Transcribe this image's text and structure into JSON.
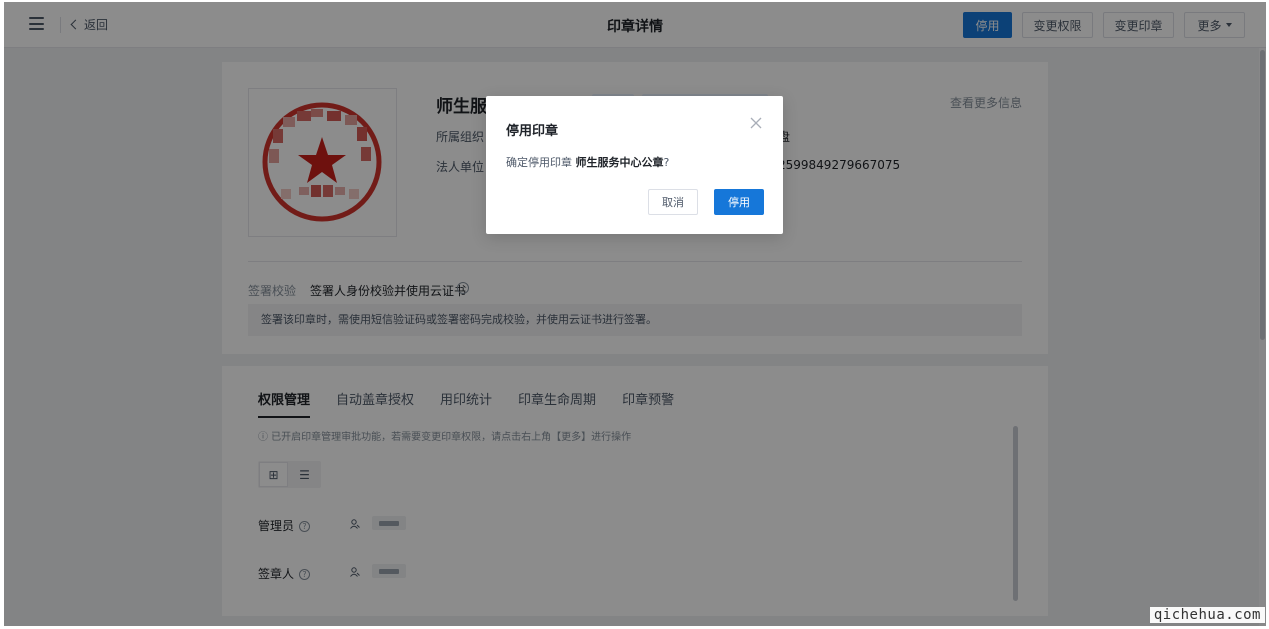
{
  "header": {
    "back_label": "返回",
    "title": "印章详情",
    "buttons": {
      "disable": "停用",
      "change_permission": "变更权限",
      "change_seal": "变更印章",
      "more": "更多"
    }
  },
  "seal": {
    "name": "师生服务中心公章",
    "org_label": "所属组织：",
    "org_value_suffix": "盘",
    "legal_label": "法人单位：",
    "legal_value_suffix": "2599849279667075",
    "more_info": "查看更多信息"
  },
  "signing": {
    "label": "签署校验",
    "value": "签署人身份校验并使用云证书",
    "description": "签署该印章时，需使用短信验证码或签署密码完成校验，并使用云证书进行签署。"
  },
  "tabs": [
    {
      "label": "权限管理",
      "active": true
    },
    {
      "label": "自动盖章授权",
      "active": false
    },
    {
      "label": "用印统计",
      "active": false
    },
    {
      "label": "印章生命周期",
      "active": false
    },
    {
      "label": "印章预警",
      "active": false
    }
  ],
  "permissions": {
    "hint": "ⓘ 已开启印章管理审批功能，若需要变更印章权限，请点击右上角【更多】进行操作",
    "view_grid_icon": "⊞",
    "view_list_icon": "☰",
    "admin_label": "管理员",
    "signer_label": "签章人",
    "help_glyph": "?"
  },
  "modal": {
    "title": "停用印章",
    "body_prefix": "确定停用印章",
    "body_name": "师生服务中心公章",
    "body_suffix": "?",
    "cancel": "取消",
    "confirm": "停用"
  },
  "watermark": "qichehua.com",
  "colors": {
    "primary": "#1677d9",
    "seal_red": "#d0342c"
  }
}
